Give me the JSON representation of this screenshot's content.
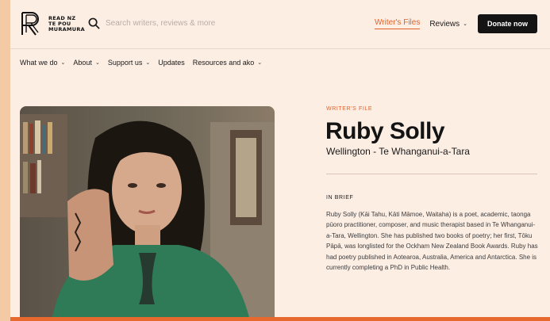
{
  "header": {
    "logo_lines": [
      "READ NZ",
      "TE POU",
      "MURAMURA"
    ],
    "search_placeholder": "Search writers, reviews & more",
    "writers_files_label": "Writer's Files",
    "reviews_label": "Reviews",
    "donate_label": "Donate now"
  },
  "menu": {
    "items": [
      {
        "label": "What we do",
        "dropdown": true
      },
      {
        "label": "About",
        "dropdown": true
      },
      {
        "label": "Support us",
        "dropdown": true
      },
      {
        "label": "Updates",
        "dropdown": false
      },
      {
        "label": "Resources and ako",
        "dropdown": true
      }
    ]
  },
  "profile": {
    "kicker": "WRITER'S FILE",
    "name": "Ruby Solly",
    "location": "Wellington - Te Whanganui-a-Tara",
    "section_label": "IN BRIEF",
    "bio": "Ruby Solly (Kāi Tahu, Kāti Māmoe, Waitaha) is a poet, academic, taonga pūoro practitioner, composer, and music therapist based in Te Whanganui-a-Tara, Wellington. She has published two books of poetry; her first, Tōku Pāpā, was longlisted for the Ockham New Zealand Book Awards. Ruby has had poetry published in Aotearoa, Australia, America and Antarctica. She is currently completing a PhD in Public Health."
  },
  "colors": {
    "background": "#fdeee4",
    "accent": "#e0622a",
    "donate_bg": "#141414"
  },
  "icons": {
    "search": "search-icon",
    "chevron": "chevron-down-icon"
  }
}
